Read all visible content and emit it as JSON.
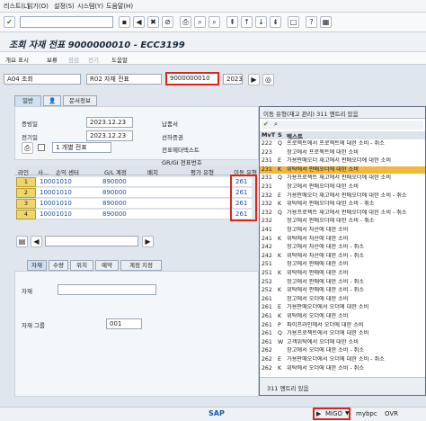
{
  "menu": [
    "리스트(L)",
    "읽기(O)",
    "설정(S)",
    "시스템(Y)",
    "도움말(H)"
  ],
  "title": "조회 자재 전표 9000000010 - ECC3199",
  "app_toolbar": [
    "개요 표시",
    "보류",
    "점검",
    "전기",
    "도움말"
  ],
  "header": {
    "action": "A04 조회",
    "ref_doc_type": "R02 자재 전표",
    "doc_number": "9000000010",
    "year": "2023"
  },
  "tabs": [
    "일반",
    "",
    "문서정보"
  ],
  "fields": {
    "doc_date_label": "증빙일",
    "doc_date": "2023.12.23",
    "post_date_label": "전기일",
    "post_date": "2023.12.23",
    "print_value": "1 개별 전표",
    "delivery_note_label": "납품서",
    "bol_label": "선하증권",
    "header_text_label": "전표헤더텍스트",
    "gr_gi_label": "GR/GI 전표번호"
  },
  "grid": {
    "headers": [
      "라인",
      "사...",
      "손익 센터",
      "G/L 계정",
      "배치",
      "평가 유형",
      "이동 유형"
    ],
    "rows": [
      {
        "line": "1",
        "plant": "1000",
        "profit_center": "1010",
        "gl": "890000",
        "mvt": "261"
      },
      {
        "line": "2",
        "plant": "1000",
        "profit_center": "1010",
        "gl": "890000",
        "mvt": "261"
      },
      {
        "line": "3",
        "plant": "1000",
        "profit_center": "1010",
        "gl": "890000",
        "mvt": "261"
      },
      {
        "line": "4",
        "plant": "1000",
        "profit_center": "1010",
        "gl": "890000",
        "mvt": "261"
      }
    ]
  },
  "subtabs": [
    "자재",
    "수량",
    "위치",
    "예약",
    "계정 지정"
  ],
  "subfields": {
    "material_label": "자재",
    "material_group_label": "자재 그룹",
    "material_group": "001"
  },
  "popup": {
    "title": "이동 유형(재고 관리) 311 엔트리 있음",
    "col_mvt": "MvT",
    "col_s": "S",
    "col_text": "텍스트",
    "rows": [
      [
        "222",
        "Q",
        "프로젝트에서 프로젝트에 대한 소비 - 취소"
      ],
      [
        "223",
        "",
        "창고에서 프로젝트에 대한 소비"
      ],
      [
        "231",
        "E",
        "가용판매오더 재고에서 판매오더에 대한 소비"
      ],
      [
        "231",
        "K",
        "위탁에서 판매오더에 대한 소비"
      ],
      [
        "231",
        "Q",
        "가용프로젝트 재고에서 판매오더에 대한 소비"
      ],
      [
        "231",
        "",
        "창고에서 판매오더에 대한 소비"
      ],
      [
        "232",
        "E",
        "가용판매오더 재고에서 판매오더에 대한 소비 - 취소"
      ],
      [
        "232",
        "K",
        "위탁에서 판매오더에 대한 소비 - 취소"
      ],
      [
        "232",
        "Q",
        "가용프로젝트 재고에서 판매오더에 대한 소비 - 취소"
      ],
      [
        "232",
        "",
        "창고에서 판매오더에 대한 소비 - 취소"
      ],
      [
        "241",
        "",
        "창고에서 자산에 대한 소비"
      ],
      [
        "241",
        "K",
        "위탁에서 자산에 대한 소비"
      ],
      [
        "242",
        "",
        "창고에서 자산에 대한 소비 - 취소"
      ],
      [
        "242",
        "K",
        "위탁에서 자산에 대한 소비 - 취소"
      ],
      [
        "251",
        "",
        "창고에서 판매에 대한 소비"
      ],
      [
        "251",
        "K",
        "위탁에서 판매에 대한 소비"
      ],
      [
        "252",
        "",
        "창고에서 판매에 대한 소비 - 취소"
      ],
      [
        "252",
        "K",
        "위탁에서 판매에 대한 소비 - 취소"
      ],
      [
        "261",
        "",
        "창고에서 오더에 대한 소비"
      ],
      [
        "261",
        "E",
        "가용판매오더에서 오더에 대한 소비"
      ],
      [
        "261",
        "K",
        "위탁에서 오더에 대한 소비"
      ],
      [
        "261",
        "P",
        "파이프라인에서 오더에 대한 소비"
      ],
      [
        "261",
        "Q",
        "가용프로젝트에서 오더에 대한 소비"
      ],
      [
        "261",
        "W",
        "고객위탁에서 오더에 대한 소비"
      ],
      [
        "262",
        "",
        "창고에서 오더에 대한 소비 - 취소"
      ],
      [
        "262",
        "E",
        "가용판매오더에서 오더에 대한 소비 - 취소"
      ],
      [
        "262",
        "K",
        "위탁에서 오더에 대한 소비 - 취소"
      ]
    ],
    "selected_index": 3,
    "footer": "311 엔트리 있음"
  },
  "status": {
    "tcode": "MIGO",
    "server": "mybpc",
    "mode": "OVR"
  },
  "colors": {
    "highlight": "#e0241c",
    "selected_row": "#f2b73b"
  }
}
